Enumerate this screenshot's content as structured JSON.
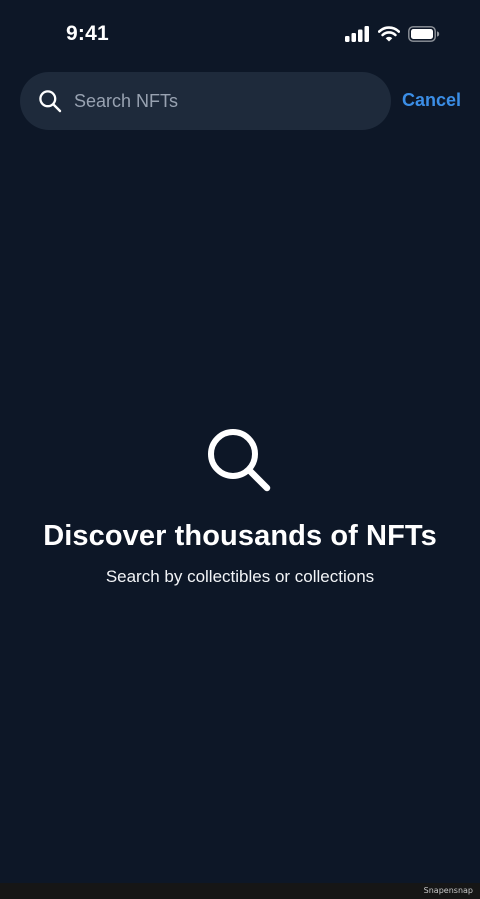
{
  "status_bar": {
    "time": "9:41",
    "icons": [
      "signal-icon",
      "wifi-icon",
      "battery-icon"
    ]
  },
  "search": {
    "placeholder": "Search NFTs",
    "value": "",
    "icon": "search-icon",
    "cancel_label": "Cancel"
  },
  "empty_state": {
    "icon": "search-icon",
    "title": "Discover thousands of NFTs",
    "subtitle": "Search by collectibles or collections"
  },
  "footer": {
    "watermark": "Snapensnap"
  },
  "colors": {
    "background": "#0d1727",
    "search_field": "#1e2a3b",
    "accent": "#3b8ee6",
    "placeholder": "#98a2b1"
  }
}
